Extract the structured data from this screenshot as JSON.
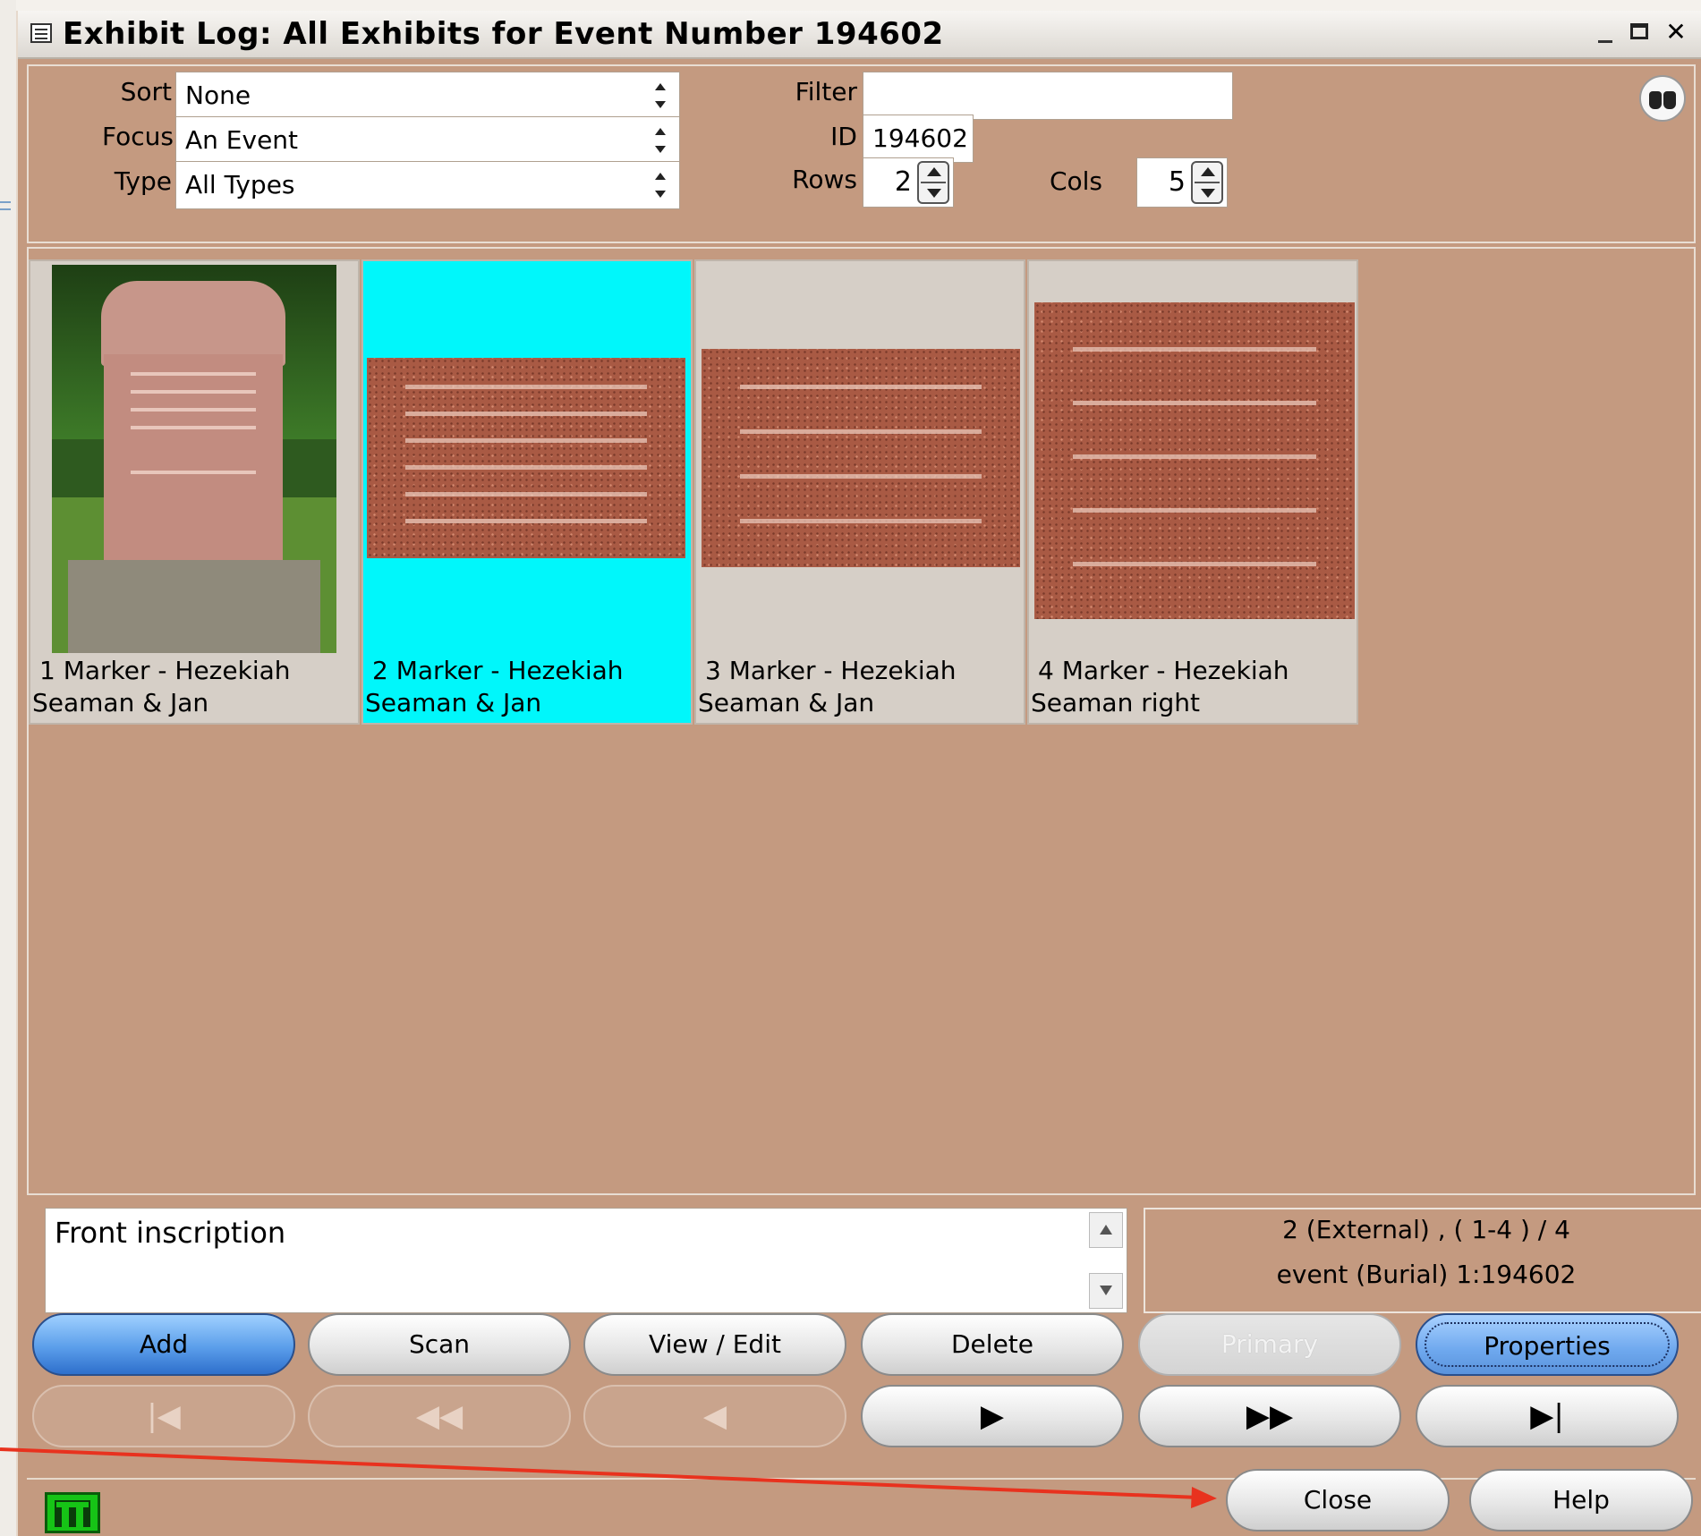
{
  "window": {
    "title": "Exhibit Log: All Exhibits for Event Number 194602",
    "icon": "list-icon"
  },
  "controls": {
    "sort_label": "Sort",
    "sort_value": "None",
    "focus_label": "Focus",
    "focus_value": "An Event",
    "type_label": "Type",
    "type_value": "All Types",
    "filter_label": "Filter",
    "filter_value": "",
    "id_label": "ID",
    "id_value": "194602",
    "rows_label": "Rows",
    "rows_value": "2",
    "cols_label": "Cols",
    "cols_value": "5"
  },
  "exhibits": [
    {
      "line1": "1 Marker - Hezekiah",
      "line2": "Seaman & Jan",
      "selected": false
    },
    {
      "line1": "2 Marker - Hezekiah",
      "line2": "Seaman & Jan",
      "selected": true
    },
    {
      "line1": "3 Marker - Hezekiah",
      "line2": "Seaman & Jan",
      "selected": false
    },
    {
      "line1": "4 Marker - Hezekiah",
      "line2": "Seaman right",
      "selected": false
    }
  ],
  "description": "Front inscription",
  "status": {
    "line1": "2 (External) , ( 1-4 ) / 4",
    "line2": "event (Burial) 1:194602"
  },
  "actions": {
    "add": "Add",
    "scan": "Scan",
    "view_edit": "View / Edit",
    "delete": "Delete",
    "primary": "Primary",
    "properties": "Properties"
  },
  "navigation": {
    "first": "|◀",
    "prev_page": "◀◀",
    "prev": "◀",
    "next": "▶",
    "next_page": "▶▶",
    "last": "▶|"
  },
  "footer": {
    "close": "Close",
    "help": "Help"
  },
  "colors": {
    "panel": "#c49a80",
    "selected_tile": "#00f7fb",
    "add_button": "#5b9eea",
    "annotation_arrow": "#e8321e"
  }
}
